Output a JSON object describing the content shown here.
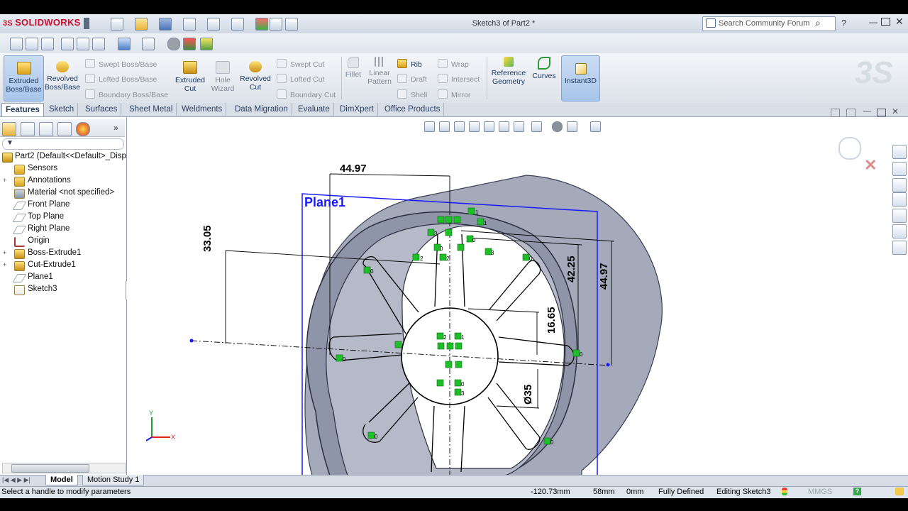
{
  "app": {
    "name": "SOLIDWORKS",
    "document_title": "Sketch3 of Part2 *"
  },
  "search": {
    "placeholder": "Search Community Forum"
  },
  "command_manager": {
    "large_buttons": [
      {
        "label": "Extruded Boss/Base",
        "l1": "Extruded",
        "l2": "Boss/Base",
        "active": true,
        "icon": "extruded-boss-icon"
      },
      {
        "label": "Revolved Boss/Base",
        "l1": "Revolved",
        "l2": "Boss/Base",
        "active": false,
        "icon": "revolved-boss-icon"
      },
      {
        "label": "Extruded Cut",
        "l1": "Extruded",
        "l2": "Cut",
        "active": false,
        "icon": "extruded-cut-icon"
      },
      {
        "label": "Hole Wizard",
        "l1": "Hole",
        "l2": "Wizard",
        "active": false,
        "icon": "hole-wizard-icon"
      },
      {
        "label": "Revolved Cut",
        "l1": "Revolved",
        "l2": "Cut",
        "active": false,
        "icon": "revolved-cut-icon"
      }
    ],
    "boss_small": [
      "Swept Boss/Base",
      "Lofted Boss/Base",
      "Boundary Boss/Base"
    ],
    "cut_small": [
      "Swept Cut",
      "Lofted Cut",
      "Boundary Cut"
    ],
    "fillet": "Fillet",
    "linear_pattern": {
      "l1": "Linear",
      "l2": "Pattern"
    },
    "feature_small": [
      "Rib",
      "Draft",
      "Shell"
    ],
    "wrap_small": [
      "Wrap",
      "Intersect",
      "Mirror"
    ],
    "reference_geometry": {
      "l1": "Reference",
      "l2": "Geometry"
    },
    "curves": "Curves",
    "instant3d": "Instant3D"
  },
  "tabs": [
    "Features",
    "Sketch",
    "Surfaces",
    "Sheet Metal",
    "Weldments",
    "Data Migration",
    "Evaluate",
    "DimXpert",
    "Office Products"
  ],
  "feature_tree": {
    "root": "Part2  (Default<<Default>_Disp",
    "items": [
      {
        "label": "Sensors",
        "icon": "sensor-icon",
        "expandable": false
      },
      {
        "label": "Annotations",
        "icon": "annotations-icon",
        "expandable": true
      },
      {
        "label": "Material <not specified>",
        "icon": "material-icon",
        "expandable": false
      },
      {
        "label": "Front Plane",
        "icon": "plane-icon",
        "expandable": false
      },
      {
        "label": "Top Plane",
        "icon": "plane-icon",
        "expandable": false
      },
      {
        "label": "Right Plane",
        "icon": "plane-icon",
        "expandable": false
      },
      {
        "label": "Origin",
        "icon": "origin-icon",
        "expandable": false
      },
      {
        "label": "Boss-Extrude1",
        "icon": "boss-extrude-icon",
        "expandable": true
      },
      {
        "label": "Cut-Extrude1",
        "icon": "cut-extrude-icon",
        "expandable": true
      },
      {
        "label": "Plane1",
        "icon": "plane-icon",
        "expandable": false
      },
      {
        "label": "Sketch3",
        "icon": "sketch-icon",
        "expandable": false
      }
    ]
  },
  "viewport": {
    "plane_label": "Plane1",
    "dimensions": [
      "44.97",
      "33.05",
      "42.25",
      "44.97",
      "16.65",
      "Ø35"
    ],
    "triad": {
      "y": "Y",
      "x": "X"
    }
  },
  "bottom_tabs": [
    "Model",
    "Motion Study 1"
  ],
  "status": {
    "message": "Select a handle to modify parameters",
    "x": "-120.73mm",
    "y": "58mm",
    "z": "0mm",
    "state": "Fully Defined",
    "mode": "Editing Sketch3",
    "units": "MMGS"
  },
  "colors": {
    "sketch_line": "#000000",
    "plane": "#1a1aff",
    "relation": "#1fbf2a",
    "body": "#9ea4b6"
  }
}
